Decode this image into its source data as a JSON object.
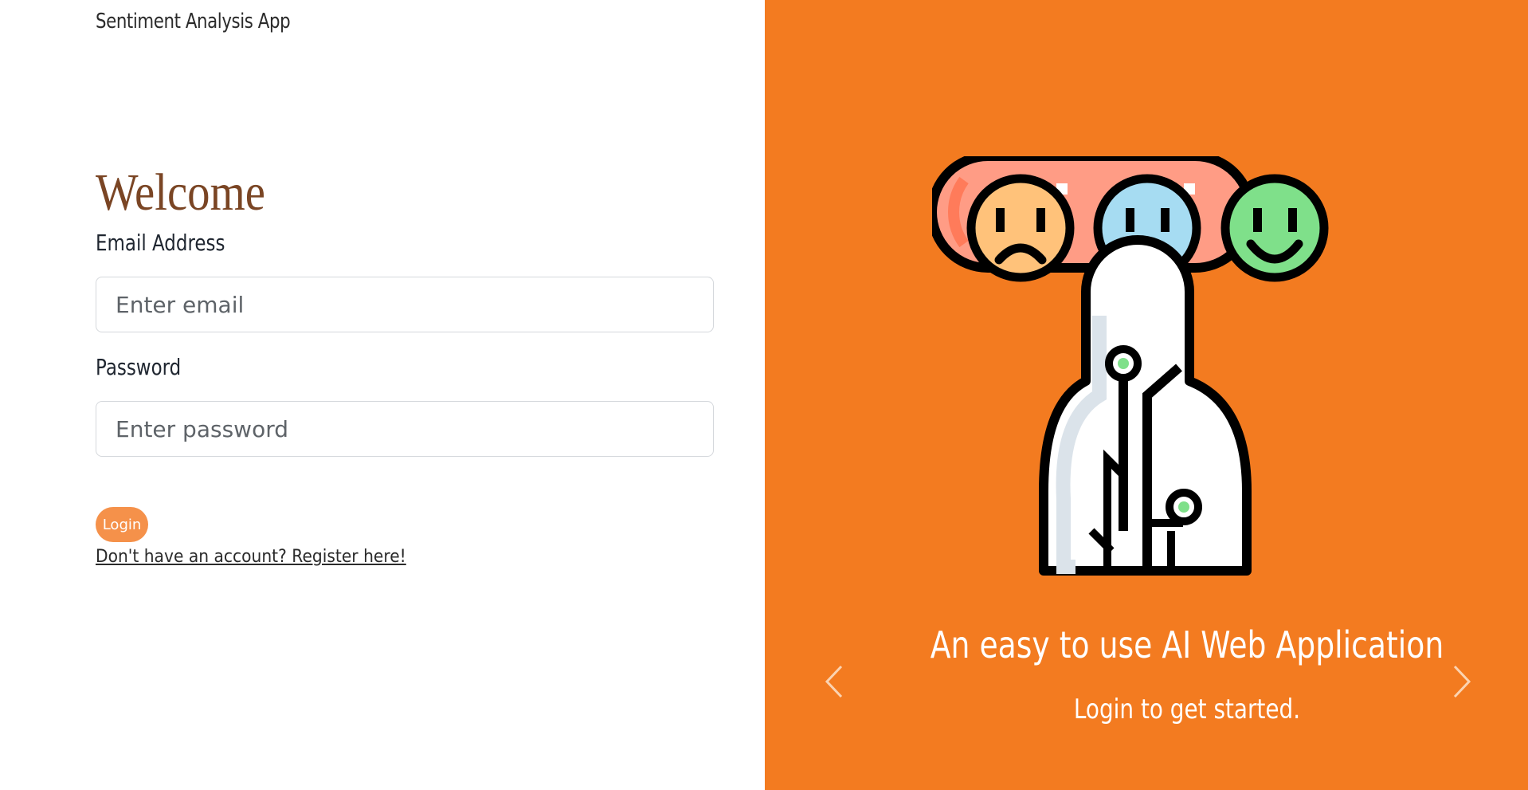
{
  "header": {
    "brand": "Sentiment Analysis App"
  },
  "form": {
    "heading": "Welcome",
    "email_label": "Email Address",
    "email_placeholder": "Enter email",
    "email_value": "",
    "password_label": "Password",
    "password_placeholder": "Enter password",
    "password_value": "",
    "login_label": "Login",
    "register_link": "Don't have an account? Register here!"
  },
  "carousel": {
    "title": "An easy to use AI Web Application",
    "subtitle": "Login to get started.",
    "prev_icon": "chevron-left-icon",
    "next_icon": "chevron-right-icon",
    "illustration": "ai-sentiment-robot-illustration"
  },
  "colors": {
    "accent": "#f37b20",
    "heading": "#7a4524",
    "button": "#f5914a"
  }
}
